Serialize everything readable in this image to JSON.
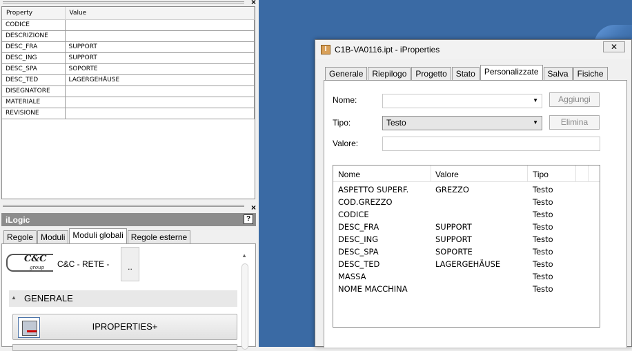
{
  "property_panel": {
    "columns": [
      "Property",
      "Value"
    ],
    "rows": [
      {
        "property": "CODICE",
        "value": ""
      },
      {
        "property": "DESCRIZIONE",
        "value": ""
      },
      {
        "property": "DESC_FRA",
        "value": "SUPPORT"
      },
      {
        "property": "DESC_ING",
        "value": "SUPPORT"
      },
      {
        "property": "DESC_SPA",
        "value": "SOPORTE"
      },
      {
        "property": "DESC_TED",
        "value": "LAGERGEHÄUSE"
      },
      {
        "property": "DISEGNATORE",
        "value": ""
      },
      {
        "property": "MATERIALE",
        "value": ""
      },
      {
        "property": "REVISIONE",
        "value": ""
      }
    ],
    "close_glyph": "×"
  },
  "ilogic": {
    "title": "iLogic",
    "help_glyph": "?",
    "close_glyph": "×",
    "tabs": [
      "Regole",
      "Moduli",
      "Moduli globali",
      "Regole esterne"
    ],
    "active_tab": "Moduli globali",
    "logo_text": "C&C",
    "logo_subtext": "group",
    "company_label": "C&C - RETE -",
    "dotdot_label": "..",
    "section_label": "GENERALE",
    "iproperties_button": "IPROPERTIES+"
  },
  "dialog": {
    "title": "C1B-VA0116.ipt - iProperties",
    "icon_letter": "I",
    "close_glyph": "✕",
    "tabs": [
      "Generale",
      "Riepilogo",
      "Progetto",
      "Stato",
      "Personalizzate",
      "Salva",
      "Fisiche"
    ],
    "active_tab": "Personalizzate",
    "nome_label": "Nome:",
    "nome_value": "",
    "tipo_label": "Tipo:",
    "tipo_value": "Testo",
    "valore_label": "Valore:",
    "valore_value": "",
    "aggiungi_label": "Aggiungi",
    "elimina_label": "Elimina",
    "list_columns": [
      "Nome",
      "Valore",
      "Tipo"
    ],
    "list_rows": [
      {
        "nome": "ASPETTO SUPERF.",
        "valore": "GREZZO",
        "tipo": "Testo"
      },
      {
        "nome": "COD.GREZZO",
        "valore": "",
        "tipo": "Testo"
      },
      {
        "nome": "CODICE",
        "valore": "",
        "tipo": "Testo"
      },
      {
        "nome": "DESC_FRA",
        "valore": "SUPPORT",
        "tipo": "Testo"
      },
      {
        "nome": "DESC_ING",
        "valore": "SUPPORT",
        "tipo": "Testo"
      },
      {
        "nome": "DESC_SPA",
        "valore": "SOPORTE",
        "tipo": "Testo"
      },
      {
        "nome": "DESC_TED",
        "valore": "LAGERGEHÄUSE",
        "tipo": "Testo"
      },
      {
        "nome": "MASSA",
        "valore": "",
        "tipo": "Testo"
      },
      {
        "nome": "NOME MACCHINA",
        "valore": "",
        "tipo": "Testo"
      }
    ]
  },
  "colors": {
    "background_blue": "#3a6aa4",
    "ilogic_title_bar": "#8c8c8c"
  }
}
